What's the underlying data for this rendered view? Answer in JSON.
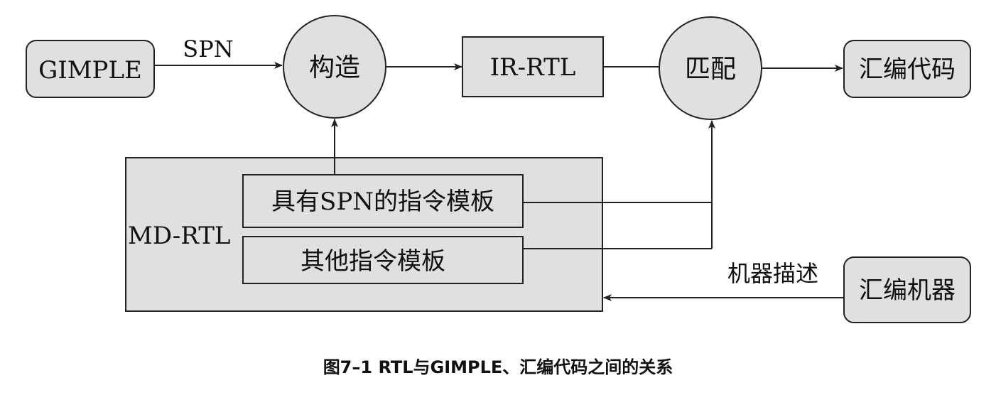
{
  "nodes": {
    "gimple": "GIMPLE",
    "construct": "构造",
    "ir_rtl": "IR-RTL",
    "match": "匹配",
    "asm_code": "汇编代码",
    "md_rtl": "MD-RTL",
    "spn_templates": "具有SPN的指令模板",
    "other_templates": "其他指令模板",
    "asm_machine": "汇编机器"
  },
  "edges": {
    "spn": "SPN",
    "machine_desc": "机器描述"
  },
  "caption": "图7–1 RTL与GIMPLE、汇编代码之间的关系",
  "colors": {
    "fill": "#e0e0e0",
    "stroke": "#222222",
    "background": "#ffffff"
  }
}
